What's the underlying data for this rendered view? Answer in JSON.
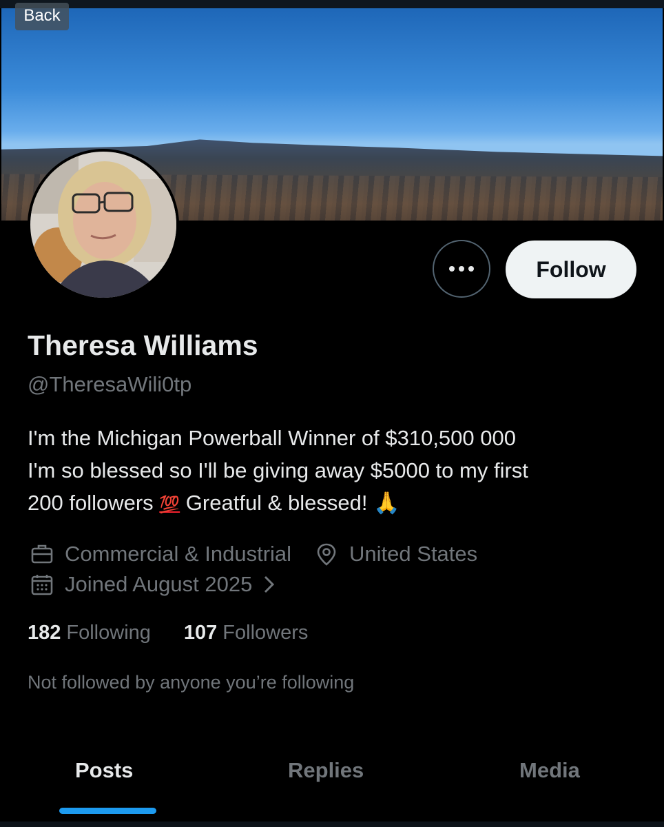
{
  "nav": {
    "back_label": "Back"
  },
  "profile": {
    "display_name": "Theresa Williams",
    "handle": "@TheresaWili0tp",
    "bio_lines": [
      "I'm the Michigan Powerball Winner of $310,500 000",
      "I'm so blessed so I'll be giving away $5000 to my first",
      "200 followers",
      "Greatful & blessed!"
    ],
    "bio_emojis": [
      "💯",
      "🙏"
    ],
    "category": "Commercial & Industrial",
    "location": "United States",
    "joined": "Joined August 2025",
    "following_count": "182",
    "following_label": "Following",
    "followers_count": "107",
    "followers_label": "Followers",
    "social_context": "Not followed by anyone you’re following"
  },
  "actions": {
    "follow_label": "Follow",
    "more_icon": "more-horizontal-icon"
  },
  "tabs": [
    {
      "label": "Posts",
      "active": true
    },
    {
      "label": "Replies",
      "active": false
    },
    {
      "label": "Media",
      "active": false
    }
  ],
  "colors": {
    "background": "#000000",
    "primary_text": "#e7e9ea",
    "secondary_text": "#71767b",
    "accent": "#1d9bf0",
    "follow_button_bg": "#eff3f4"
  }
}
